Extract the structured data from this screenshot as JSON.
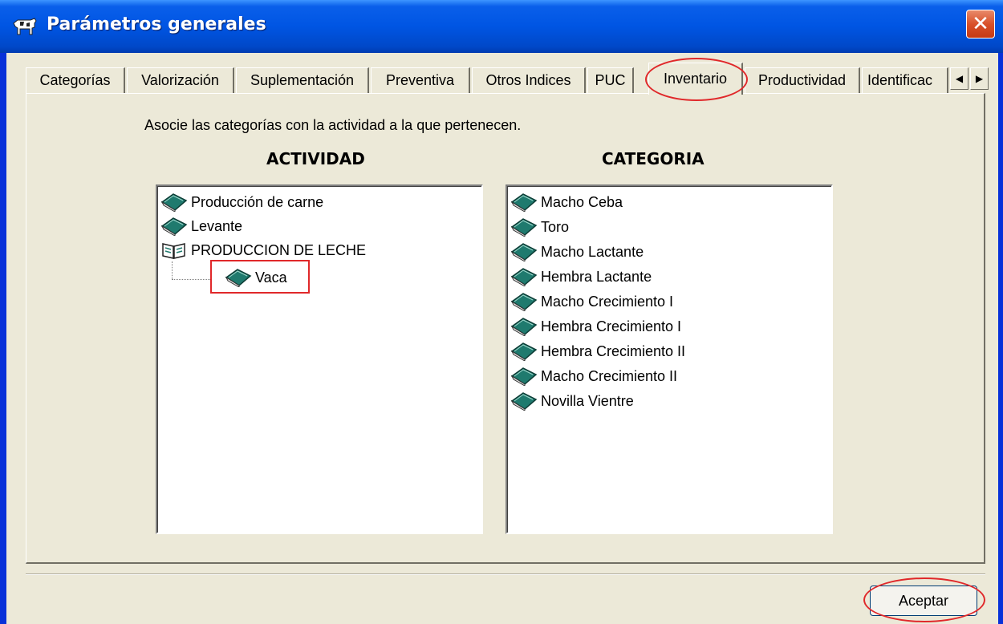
{
  "window": {
    "title": "Parámetros generales",
    "close_label": "✕"
  },
  "tabs": [
    {
      "label": "Categorías"
    },
    {
      "label": "Valorización"
    },
    {
      "label": "Suplementación"
    },
    {
      "label": "Preventiva"
    },
    {
      "label": "Otros Indices"
    },
    {
      "label": "PUC"
    },
    {
      "label": "Inventario",
      "active": true
    },
    {
      "label": "Productividad"
    },
    {
      "label": "Identificac"
    }
  ],
  "scroll": {
    "left": "◀",
    "right": "▶"
  },
  "instruction": "Asocie las categorías con la actividad a la que pertenecen.",
  "actividad": {
    "header": "ACTIVIDAD",
    "items": [
      {
        "label": "Producción de carne",
        "icon": "closed-book-icon"
      },
      {
        "label": "Levante",
        "icon": "closed-book-icon"
      },
      {
        "label": "PRODUCCION DE LECHE",
        "icon": "open-book-icon"
      },
      {
        "label": "Vaca",
        "icon": "closed-book-icon",
        "child": true
      }
    ]
  },
  "categoria": {
    "header": "CATEGORIA",
    "items": [
      {
        "label": "Macho Ceba"
      },
      {
        "label": "Toro"
      },
      {
        "label": "Macho Lactante"
      },
      {
        "label": "Hembra Lactante"
      },
      {
        "label": "Macho Crecimiento I"
      },
      {
        "label": "Hembra Crecimiento I"
      },
      {
        "label": "Hembra Crecimiento II"
      },
      {
        "label": "Macho Crecimiento II"
      },
      {
        "label": "Novilla Vientre"
      }
    ]
  },
  "buttons": {
    "accept": "Aceptar"
  },
  "colors": {
    "title_bar": "#0055E3",
    "face": "#ECE9D8",
    "annotation": "#E0282A",
    "close": "#D9512A"
  }
}
